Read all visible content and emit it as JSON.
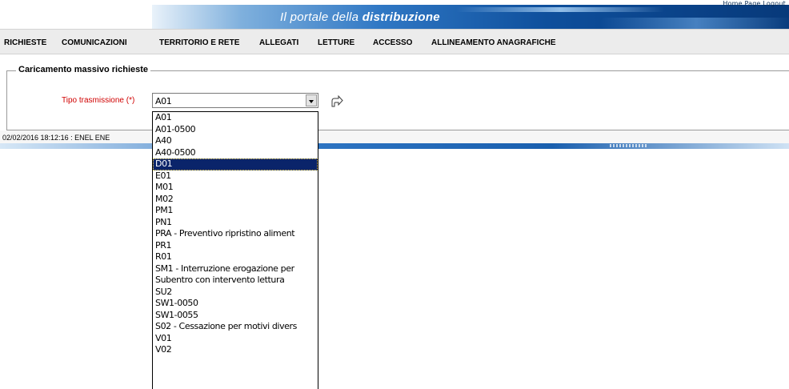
{
  "banner": {
    "title_prefix": "Il portale della",
    "title_bold": "distribuzione",
    "top_links": "Home Page  Logout"
  },
  "menu": {
    "items": [
      {
        "label": "RICHIESTE"
      },
      {
        "label": "COMUNICAZIONI"
      },
      {
        "label": "TERRITORIO E RETE"
      },
      {
        "label": "ALLEGATI"
      },
      {
        "label": "LETTURE"
      },
      {
        "label": "ACCESSO"
      },
      {
        "label": "ALLINEAMENTO ANAGRAFICHE"
      }
    ]
  },
  "form": {
    "legend": "Caricamento massivo richieste",
    "tipo_label": "Tipo trasmissione (*)",
    "tipo_value": "A01",
    "send_icon": "send-arrow-icon"
  },
  "dropdown": {
    "selected_index": 4,
    "options": [
      "A01",
      "A01-0500",
      "A40",
      "A40-0500",
      "D01",
      "E01",
      "M01",
      "M02",
      "PM1",
      "PN1",
      "PRA - Preventivo ripristino aliment",
      "PR1",
      "R01",
      "SM1 - Interruzione erogazione per",
      "Subentro con intervento lettura",
      "SU2",
      "SW1-0050",
      "SW1-0055",
      "S02 - Cessazione per motivi divers",
      "V01",
      "V02"
    ]
  },
  "status": {
    "text": "02/02/2016 18:12:16  :  ENEL ENE"
  },
  "colors": {
    "label_red": "#d00000",
    "selection_blue": "#0a246a",
    "banner_blue": "#0e4f9c"
  }
}
